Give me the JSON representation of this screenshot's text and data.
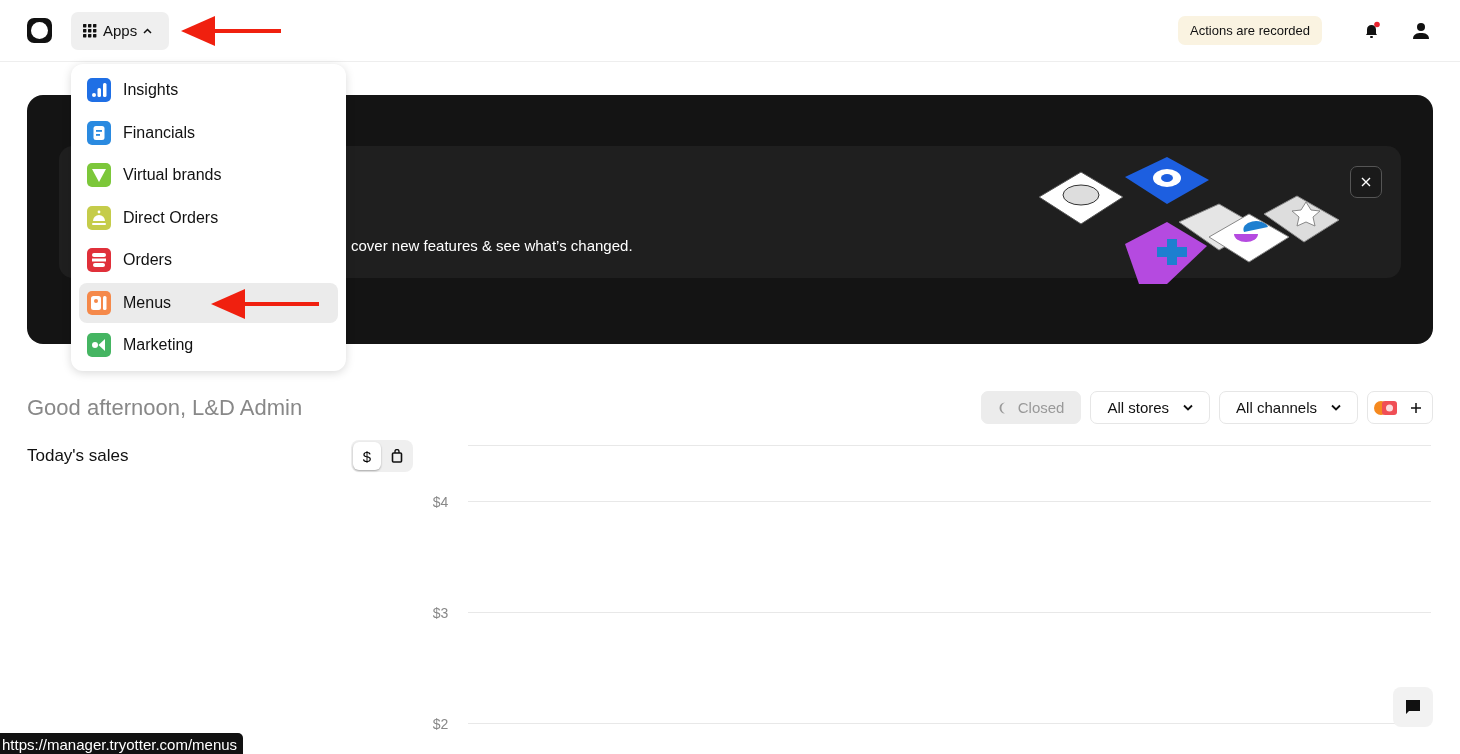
{
  "header": {
    "apps_button": {
      "label": "Apps",
      "expanded": true
    },
    "recording_badge": "Actions are recorded",
    "notifications": {
      "unread": true
    }
  },
  "banner": {
    "description_visible": "cover new features & see what’s changed."
  },
  "apps_menu": [
    {
      "label": "Insights",
      "color": "#1f6fe5",
      "selected": false
    },
    {
      "label": "Financials",
      "color": "#2a8ae0",
      "selected": false
    },
    {
      "label": "Virtual brands",
      "color": "#7cc73a",
      "selected": false
    },
    {
      "label": "Direct Orders",
      "color": "#c5cc4a",
      "selected": false
    },
    {
      "label": "Orders",
      "color": "#e0303a",
      "selected": false
    },
    {
      "label": "Menus",
      "color": "#f5894a",
      "selected": true
    },
    {
      "label": "Marketing",
      "color": "#45b562",
      "selected": false
    }
  ],
  "greeting": "Good afternoon, L&D Admin",
  "filters": {
    "status": {
      "label": "Closed",
      "disabled": true
    },
    "stores": "All stores",
    "channels": "All channels"
  },
  "sales": {
    "title": "Today's sales",
    "toggle": [
      {
        "kind": "text",
        "label": "$",
        "selected": true
      },
      {
        "kind": "bag",
        "selected": false
      }
    ]
  },
  "chart": {
    "y_labels": [
      "$4",
      "$3",
      "$2"
    ]
  },
  "status_url": "https://manager.tryotter.com/menus"
}
